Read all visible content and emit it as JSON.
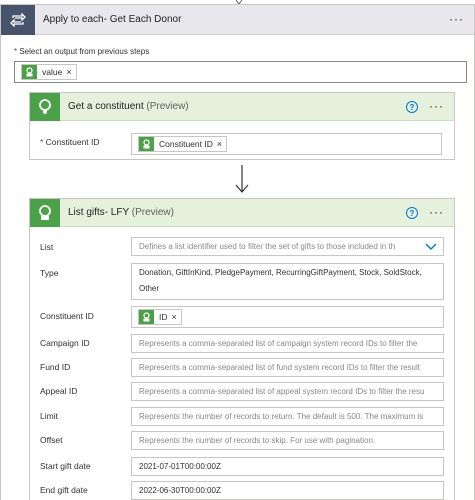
{
  "foreach": {
    "title": "Apply to each- Get Each Donor",
    "select_label": "Select an output from previous steps",
    "select_token": "value",
    "more": "···"
  },
  "card1": {
    "title": "Get a constituent",
    "preview": "(Preview)",
    "help": "?",
    "more": "···",
    "constituent_label": "Constituent ID",
    "constituent_token": "Constituent ID"
  },
  "card2": {
    "title": "List gifts- LFY",
    "preview": "(Preview)",
    "help": "?",
    "more": "···",
    "fields": {
      "list": {
        "label": "List",
        "placeholder": "Defines a list identifier used to filter the set of gifts to those included in th"
      },
      "type": {
        "label": "Type",
        "line1": "Donation, GiftInKind, PledgePayment, RecurringGiftPayment, Stock, SoldStock,",
        "line2": "Other"
      },
      "constituent": {
        "label": "Constituent ID",
        "token": "ID"
      },
      "campaign": {
        "label": "Campaign ID",
        "placeholder": "Represents a comma-separated list of campaign system record IDs to filter the"
      },
      "fund": {
        "label": "Fund ID",
        "placeholder": "Represents a comma-separated list of fund system record IDs to filter the result"
      },
      "appeal": {
        "label": "Appeal ID",
        "placeholder": "Represents a comma-separated list of appeal system record IDs to filter the resu"
      },
      "limit": {
        "label": "Limit",
        "placeholder": "Represents the number of records to return. The default is 500. The maximum is"
      },
      "offset": {
        "label": "Offset",
        "placeholder": "Represents the number of records to skip. For use with pagination."
      },
      "start_date": {
        "label": "Start gift date",
        "value": "2021-07-01T00:00:00Z"
      },
      "end_date": {
        "label": "End gift date",
        "value": "2022-06-30T00:00:00Z"
      }
    }
  },
  "colors": {
    "foreach_icon_bg": "#47536a",
    "connector_green": "#4ba048",
    "card_header_bg": "#e5f1dd",
    "accent_blue": "#0078d4",
    "required_red": "#a4262c"
  },
  "icons": [
    "loop-icon",
    "connector-icon",
    "help-icon",
    "more-icon",
    "remove-token-icon",
    "chevron-down-icon",
    "arrow-down-icon"
  ]
}
